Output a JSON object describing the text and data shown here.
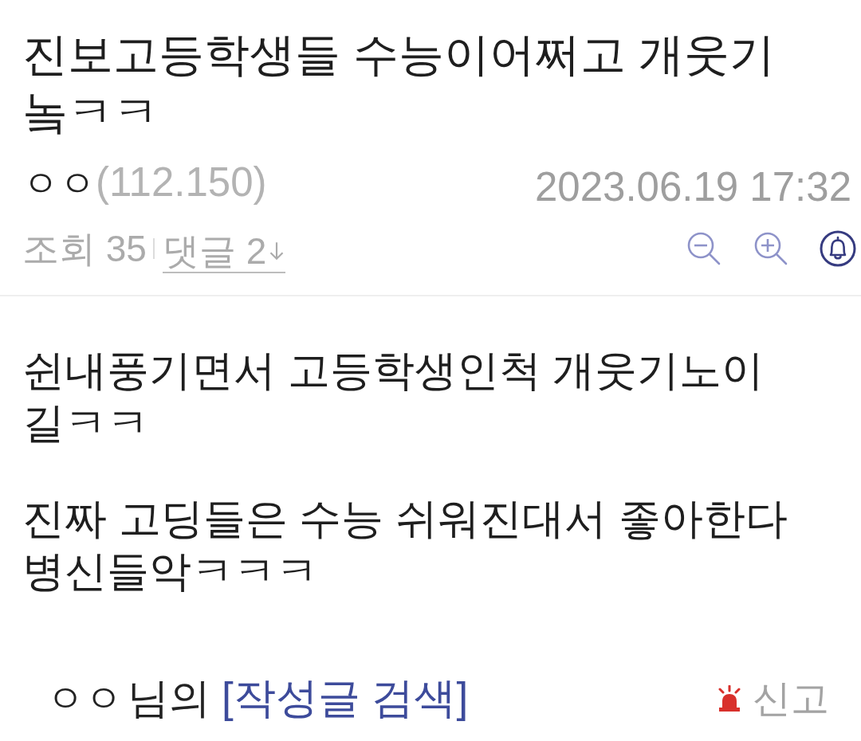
{
  "post": {
    "title": "진보고등학생들 수능이어쩌고 개웃기놐ㅋㅋ",
    "author": "ㅇㅇ",
    "ip": "(112.150)",
    "date": "2023.06.19 17:32",
    "views": "조회 35",
    "comments_link": "댓글 2"
  },
  "body": {
    "paragraphs": [
      "쉰내풍기면서 고등학생인척 개웃기노이길ㅋㅋ",
      "진짜 고딩들은 수능 쉬워진대서 좋아한다 병신들악ㅋㅋㅋ"
    ]
  },
  "footer": {
    "author": "ㅇㅇ",
    "suffix": "님의",
    "search_link": "[작성글 검색]",
    "report": "신고"
  }
}
